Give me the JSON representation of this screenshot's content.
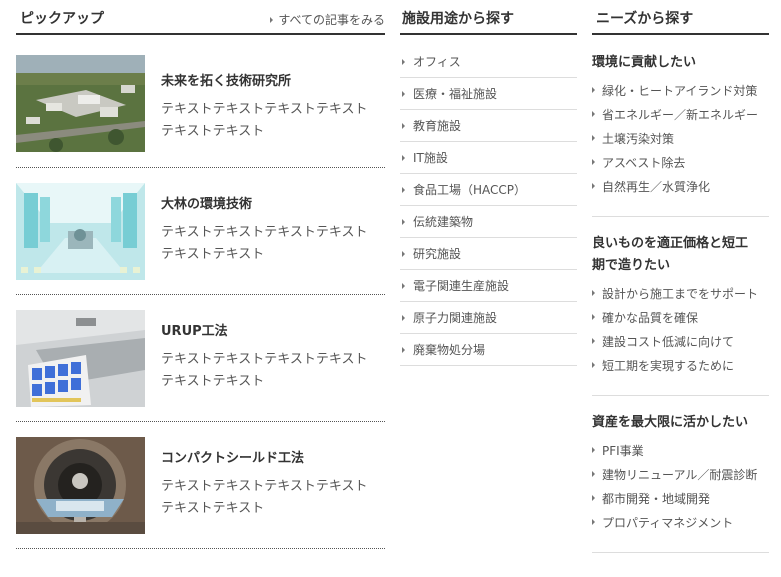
{
  "pickup": {
    "title": "ピックアップ",
    "more_label": "すべての記事をみる",
    "items": [
      {
        "title": "未来を拓く技術研究所",
        "desc1": "テキストテキストテキストテキスト",
        "desc2": "テキストテキスト"
      },
      {
        "title": "大林の環境技術",
        "desc1": "テキストテキストテキストテキスト",
        "desc2": "テキストテキスト"
      },
      {
        "title": "URUP工法",
        "desc1": "テキストテキストテキストテキスト",
        "desc2": "テキストテキスト"
      },
      {
        "title": "コンパクトシールド工法",
        "desc1": "テキストテキストテキストテキスト",
        "desc2": "テキストテキスト"
      }
    ]
  },
  "facility": {
    "title": "施設用途から探す",
    "items": [
      "オフィス",
      "医療・福祉施設",
      "教育施設",
      "IT施設",
      "食品工場（HACCP）",
      "伝統建築物",
      "研究施設",
      "電子関連生産施設",
      "原子力関連施設",
      "廃棄物処分場"
    ]
  },
  "needs": {
    "title": "ニーズから探す",
    "groups": [
      {
        "title": "環境に貢献したい",
        "items": [
          "緑化・ヒートアイランド対策",
          "省エネルギー／新エネルギー",
          "土壌汚染対策",
          "アスベスト除去",
          "自然再生／水質浄化"
        ]
      },
      {
        "title1": "良いものを適正価格と短工",
        "title2": "期で造りたい",
        "items": [
          "設計から施工までをサポート",
          "確かな品質を確保",
          "建設コスト低減に向けて",
          "短工期を実現するために"
        ]
      },
      {
        "title": "資産を最大限に活かしたい",
        "items": [
          "PFI事業",
          "建物リニューアル／耐震診断",
          "都市開発・地域開発",
          "プロパティマネジメント"
        ]
      }
    ]
  },
  "colors": {
    "text": "#333333",
    "muted": "#555555",
    "rule": "#dddddd"
  }
}
